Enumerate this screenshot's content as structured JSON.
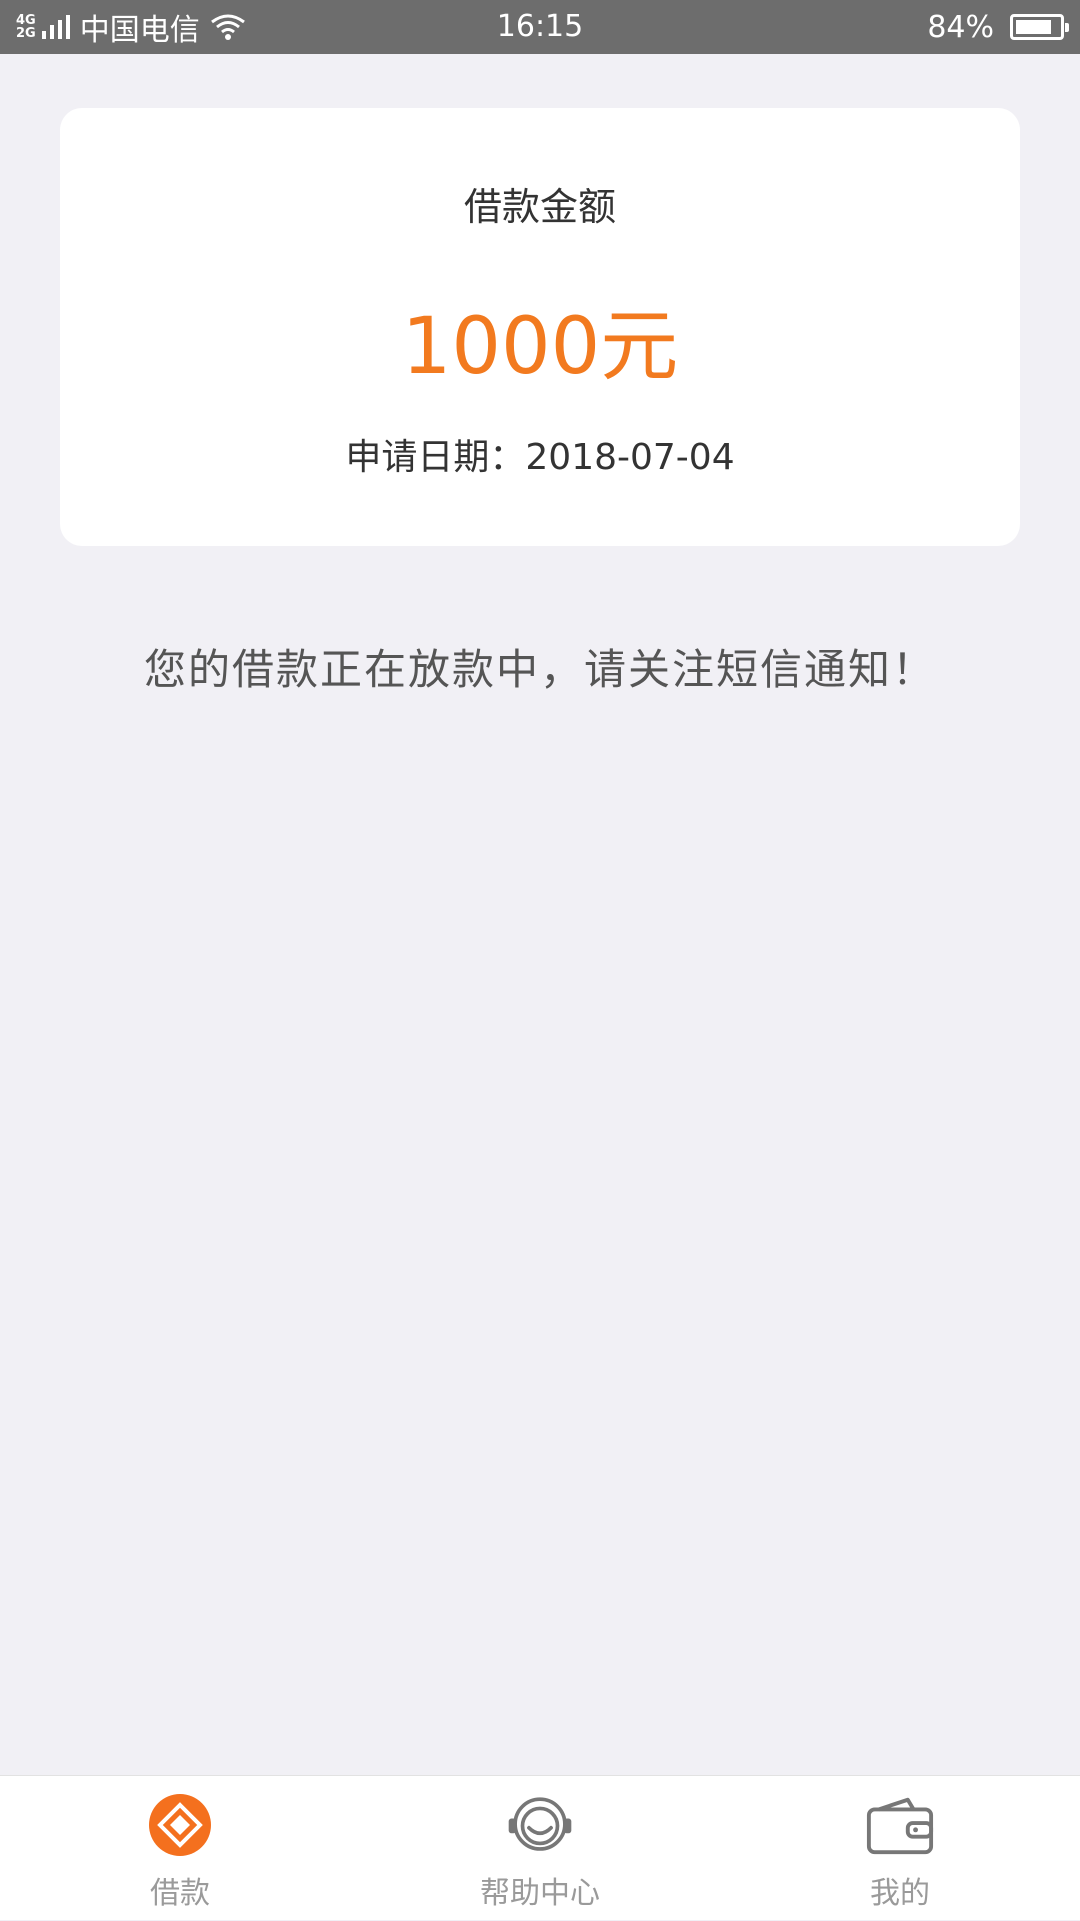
{
  "status_bar": {
    "network_top": "4G",
    "network_bottom": "2G",
    "carrier": "中国电信",
    "time": "16:15",
    "battery_percent": "84%",
    "battery_level": 0.84
  },
  "loan_card": {
    "title": "借款金额",
    "amount": "1000元",
    "date": "申请日期：2018-07-04"
  },
  "notice": "您的借款正在放款中，请关注短信通知！",
  "tabs": [
    {
      "label": "借款",
      "icon": "loan-icon",
      "active": true
    },
    {
      "label": "帮助中心",
      "icon": "help-center-icon",
      "active": false
    },
    {
      "label": "我的",
      "icon": "wallet-icon",
      "active": false
    }
  ],
  "colors": {
    "accent": "#f27a1f",
    "background": "#f1f0f5",
    "status_bar": "#6d6d6d"
  }
}
